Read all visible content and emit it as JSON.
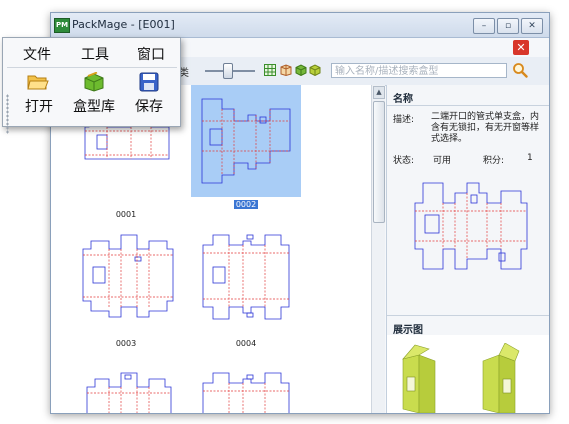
{
  "window": {
    "title": "PackMage - [E001]",
    "logo_text": "PM",
    "minimize": "–",
    "restore": "▫",
    "close": "✕"
  },
  "toolbar": {
    "category_suffix": "类",
    "search_placeholder": "输入名称/描述搜索盒型"
  },
  "menu": {
    "items": [
      "文件",
      "工具",
      "窗口"
    ],
    "buttons": [
      {
        "label": "打开",
        "icon": "open-folder-icon"
      },
      {
        "label": "盒型库",
        "icon": "box-library-icon"
      },
      {
        "label": "保存",
        "icon": "save-disk-icon"
      }
    ]
  },
  "list": {
    "items": [
      {
        "code": "0001"
      },
      {
        "code": "0002",
        "selected": true
      },
      {
        "code": "0003"
      },
      {
        "code": "0004"
      },
      {
        "code": ""
      },
      {
        "code": ""
      }
    ]
  },
  "details": {
    "section_title": "名称",
    "desc_label": "描述:",
    "desc_text": "二端开口的管式单支盒，内含有无锁扣，有无开窗等样式选择。",
    "status_label": "状态:",
    "status_value": "可用",
    "score_label": "积分:",
    "score_value": "1",
    "preview_title": "展示图"
  },
  "colors": {
    "cut_line": "#2b35d6",
    "fold_line": "#e23a3a",
    "selection": "#a9cdf6",
    "box_green": "#c9dc4e"
  }
}
